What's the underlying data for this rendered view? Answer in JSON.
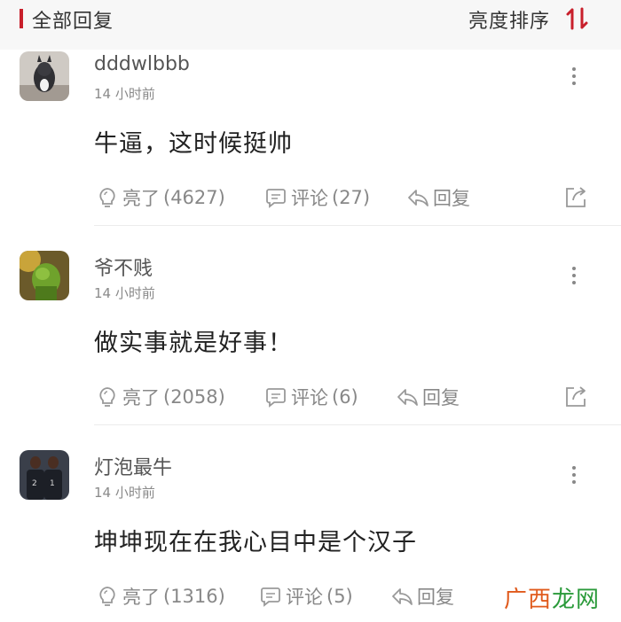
{
  "header": {
    "title": "全部回复",
    "sort_label": "亮度排序"
  },
  "colors": {
    "accent": "#c81f2b",
    "watermark_1": "#e05a1c",
    "watermark_2": "#2a9a3a"
  },
  "comments": [
    {
      "username": "dddwlbbb",
      "time": "14 小时前",
      "content": "牛逼，这时候挺帅",
      "likes_label": "亮了",
      "likes": "(4627)",
      "comments_label": "评论",
      "comments": "(27)",
      "reply_label": "回复"
    },
    {
      "username": "爷不贱",
      "time": "14 小时前",
      "content": "做实事就是好事！",
      "likes_label": "亮了",
      "likes": "(2058)",
      "comments_label": "评论",
      "comments": "(6)",
      "reply_label": "回复"
    },
    {
      "username": "灯泡最牛",
      "time": "14 小时前",
      "content": "坤坤现在在我心目中是个汉子",
      "likes_label": "亮了",
      "likes": "(1316)",
      "comments_label": "评论",
      "comments": "(5)",
      "reply_label": "回复"
    }
  ],
  "watermark": {
    "part1": "广西",
    "part2": "龙网"
  }
}
